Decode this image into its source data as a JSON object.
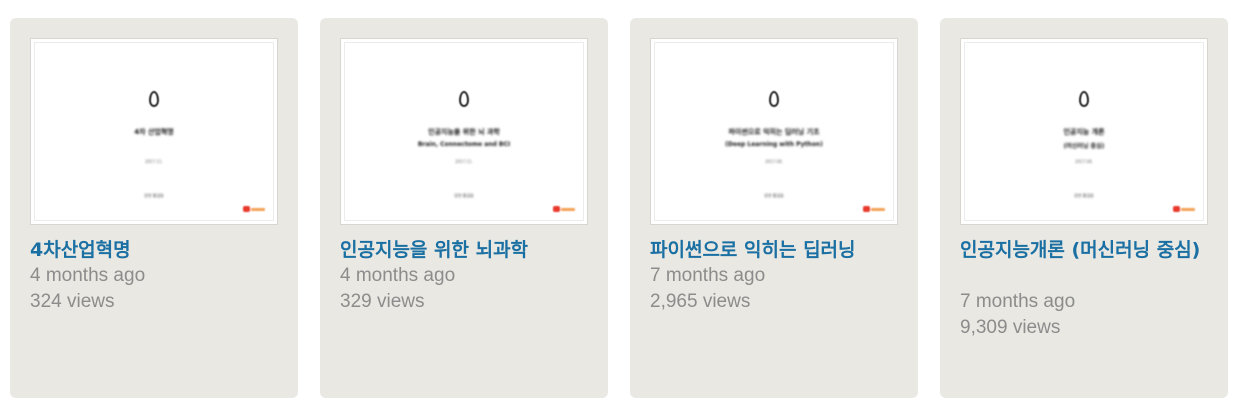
{
  "cards": [
    {
      "title": "4차산업혁명",
      "age": "4 months ago",
      "views": "324 views",
      "slide": {
        "line1": "4차 산업혁명",
        "line2": "",
        "date": "2017.11.",
        "author": "강연 홍길동"
      }
    },
    {
      "title": "인공지능을 위한 뇌과학",
      "age": "4 months ago",
      "views": "329 views",
      "slide": {
        "line1": "인공지능을 위한 뇌 과학",
        "line2": "Brain, Connectome and BCI",
        "date": "2017.11.",
        "author": "강연 홍길동"
      }
    },
    {
      "title": "파이썬으로 익히는 딥러닝",
      "age": "7 months ago",
      "views": "2,965 views",
      "slide": {
        "line1": "파이썬으로 익히는 딥러닝 기초",
        "line2": "(Deep Learning with Python)",
        "date": "2017.08.",
        "author": "강연 홍길동"
      }
    },
    {
      "title": "인공지능개론 (머신러닝 중심)",
      "age": "7 months ago",
      "views": "9,309 views",
      "slide": {
        "line1": "인공지능 개론",
        "line2": "(머신러닝 중심)",
        "date": "2017.08.",
        "author": "강연 홍길동"
      }
    }
  ],
  "colors": {
    "card_bg": "#e9e8e3",
    "title": "#1a6fa3",
    "meta": "#8c8c8c"
  }
}
